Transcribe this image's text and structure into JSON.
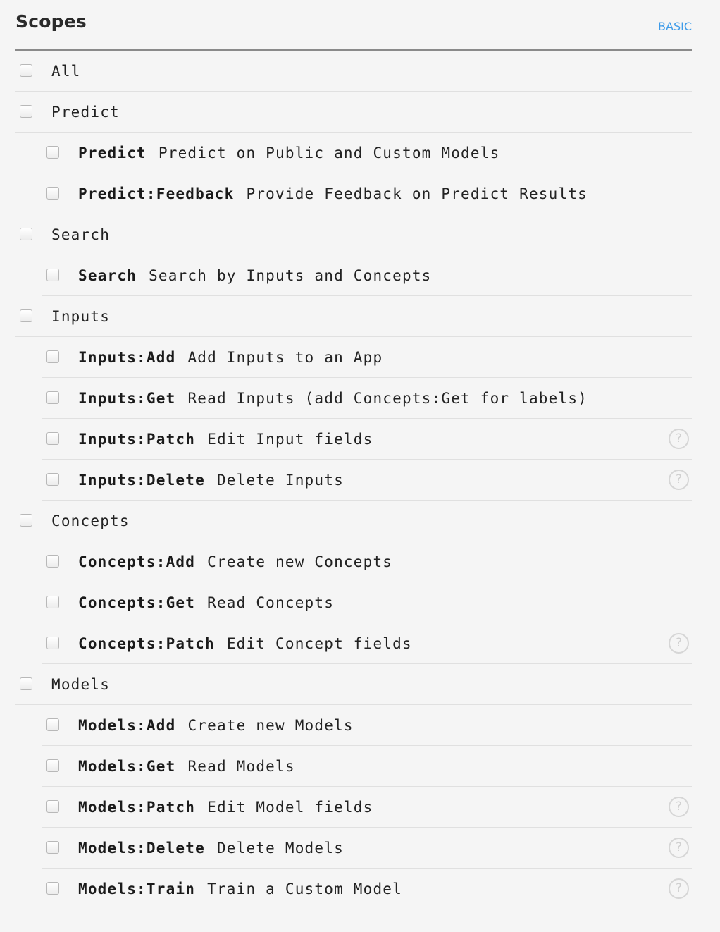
{
  "header": {
    "title": "Scopes",
    "mode_link": "BASIC"
  },
  "help_icon_glyph": "?",
  "rows": [
    {
      "type": "group",
      "label": "All"
    },
    {
      "type": "group",
      "label": "Predict"
    },
    {
      "type": "item",
      "name": "Predict",
      "desc": "Predict on Public and Custom Models",
      "help": false
    },
    {
      "type": "item",
      "name": "Predict:Feedback",
      "desc": "Provide Feedback on Predict Results",
      "help": false
    },
    {
      "type": "group",
      "label": "Search"
    },
    {
      "type": "item",
      "name": "Search",
      "desc": "Search by Inputs and Concepts",
      "help": false
    },
    {
      "type": "group",
      "label": "Inputs"
    },
    {
      "type": "item",
      "name": "Inputs:Add",
      "desc": "Add Inputs to an App",
      "help": false
    },
    {
      "type": "item",
      "name": "Inputs:Get",
      "desc": "Read Inputs (add Concepts:Get for labels)",
      "help": false
    },
    {
      "type": "item",
      "name": "Inputs:Patch",
      "desc": "Edit Input fields",
      "help": true
    },
    {
      "type": "item",
      "name": "Inputs:Delete",
      "desc": "Delete Inputs",
      "help": true
    },
    {
      "type": "group",
      "label": "Concepts"
    },
    {
      "type": "item",
      "name": "Concepts:Add",
      "desc": "Create new Concepts",
      "help": false
    },
    {
      "type": "item",
      "name": "Concepts:Get",
      "desc": "Read Concepts",
      "help": false
    },
    {
      "type": "item",
      "name": "Concepts:Patch",
      "desc": "Edit Concept fields",
      "help": true
    },
    {
      "type": "group",
      "label": "Models"
    },
    {
      "type": "item",
      "name": "Models:Add",
      "desc": "Create new Models",
      "help": false
    },
    {
      "type": "item",
      "name": "Models:Get",
      "desc": "Read Models",
      "help": false
    },
    {
      "type": "item",
      "name": "Models:Patch",
      "desc": "Edit Model fields",
      "help": true
    },
    {
      "type": "item",
      "name": "Models:Delete",
      "desc": "Delete Models",
      "help": true
    },
    {
      "type": "item",
      "name": "Models:Train",
      "desc": "Train a Custom Model",
      "help": true
    }
  ]
}
